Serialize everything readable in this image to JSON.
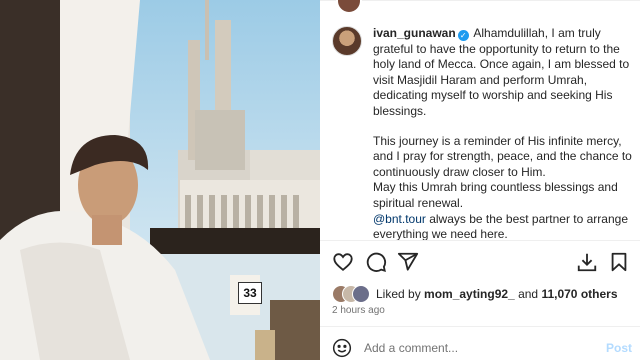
{
  "caption": {
    "username": "ivan_gunawan",
    "paragraph1": "Alhamdulillah, I am truly grateful to have the opportunity to return to the holy land of Mecca. Once again, I am blessed to visit Masjidil Haram and perform Umrah, dedicating myself to worship and seeking His blessings.",
    "paragraph2": "This journey is a reminder of His infinite mercy, and I pray for strength, peace, and the chance to continuously draw closer to Him.",
    "paragraph3": "May this Umrah bring countless blessings and spiritual renewal.",
    "mention": "@bnt.tour",
    "paragraph4_rest": " always be the best partner to arrange everything we need here."
  },
  "photo": {
    "window_number": "33"
  },
  "actions": {
    "like": "heart-icon",
    "comment": "comment-icon",
    "share": "share-icon",
    "download": "download-icon",
    "save": "bookmark-icon"
  },
  "likes": {
    "prefix": "Liked by ",
    "user": "mom_ayting92_",
    "middle": " and ",
    "count": "11,070 others"
  },
  "timestamp": "2 hours ago",
  "comment_box": {
    "placeholder": "Add a comment...",
    "post_label": "Post"
  },
  "colors": {
    "verified": "#1d9bf0",
    "mention": "#00376b",
    "post_disabled": "#b3dbff"
  }
}
